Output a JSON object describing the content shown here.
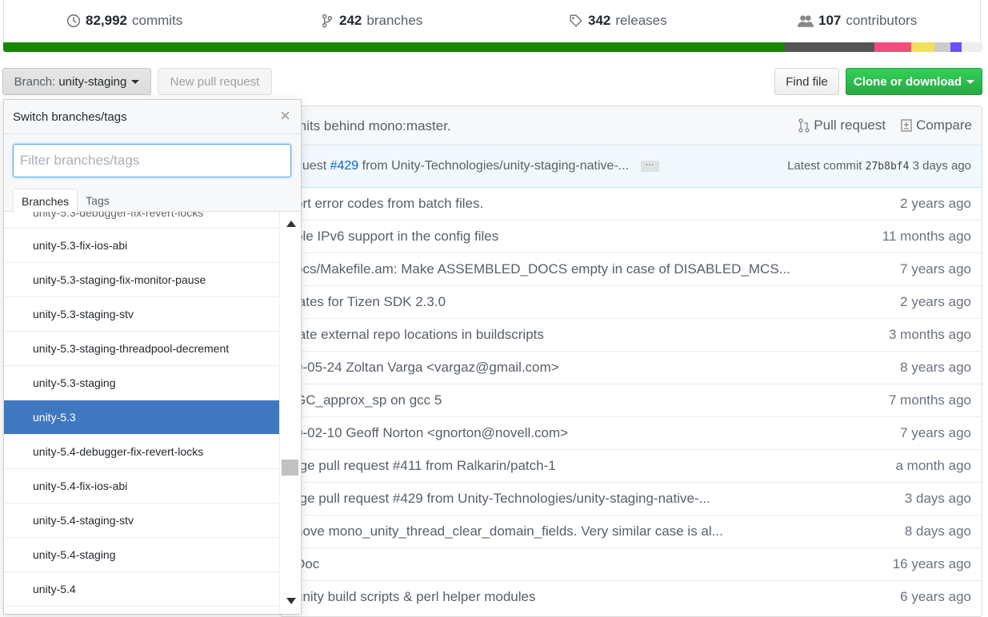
{
  "summary": {
    "commits": {
      "count": "82,992",
      "label": "commits",
      "icon": "history-icon"
    },
    "branches": {
      "count": "242",
      "label": "branches",
      "icon": "git-branch-icon"
    },
    "releases": {
      "count": "342",
      "label": "releases",
      "icon": "tag-icon"
    },
    "contributors": {
      "count": "107",
      "label": "contributors",
      "icon": "people-icon"
    }
  },
  "language_bar": [
    {
      "color": "#178600",
      "fraction": 0.797
    },
    {
      "color": "#555555",
      "fraction": 0.093
    },
    {
      "color": "#f34b7d",
      "fraction": 0.037
    },
    {
      "color": "#f1e05a",
      "fraction": 0.024
    },
    {
      "color": "#cccccc",
      "fraction": 0.016
    },
    {
      "color": "#6e4cff",
      "fraction": 0.012
    },
    {
      "color": "#ededed",
      "fraction": 0.021
    }
  ],
  "toolbar": {
    "branch_prefix": "Branch:",
    "branch_name": "unity-staging",
    "new_pr": "New pull request",
    "find_file": "Find file",
    "clone": "Clone or download"
  },
  "status": {
    "text": "mits behind mono:master.",
    "pull_request": "Pull request",
    "compare": "Compare"
  },
  "latest_commit": {
    "prefix": "quest",
    "pr_link": "#429",
    "rest": "from Unity-Technologies/unity-staging-native-...",
    "ellipsis": "···",
    "label": "Latest commit",
    "sha": "27b8bf4",
    "age": "3 days ago"
  },
  "files": [
    {
      "message": "ort error codes from batch files.",
      "age": "2 years ago"
    },
    {
      "message": "ble IPv6 support in the config files",
      "age": "11 months ago"
    },
    {
      "message": "ocs/Makefile.am: Make ASSEMBLED_DOCS empty in case of DISABLED_MCS...",
      "age": "7 years ago"
    },
    {
      "message": "lates for Tizen SDK 2.3.0",
      "age": "2 years ago"
    },
    {
      "message": "late external repo locations in buildscripts",
      "age": "3 months ago"
    },
    {
      "message": "9-05-24 Zoltan Varga <vargaz@gmail.com>",
      "age": "8 years ago"
    },
    {
      "message": "GC_approx_sp on gcc 5",
      "age": "7 months ago"
    },
    {
      "message": "0-02-10 Geoff Norton <gnorton@novell.com>",
      "age": "7 years ago"
    },
    {
      "message": "rge pull request #411 from Ralkarin/patch-1",
      "age": "a month ago"
    },
    {
      "message": "rge pull request #429 from Unity-Technologies/unity-staging-native-...",
      "age": "3 days ago"
    },
    {
      "message": "nove mono_unity_thread_clear_domain_fields. Very similar case is al...",
      "age": "8 days ago"
    },
    {
      "message": "Doc",
      "age": "16 years ago"
    },
    {
      "message": "unity build scripts & perl helper modules",
      "age": "6 years ago"
    }
  ],
  "dropdown": {
    "title": "Switch branches/tags",
    "close": "×",
    "filter_placeholder": "Filter branches/tags",
    "tabs": [
      "Branches",
      "Tags"
    ],
    "partial_item": "unity-5.3-debugger-fix-revert-locks",
    "items": [
      "unity-5.3-fix-ios-abi",
      "unity-5.3-staging-fix-monitor-pause",
      "unity-5.3-staging-stv",
      "unity-5.3-staging-threadpool-decrement",
      "unity-5.3-staging",
      "unity-5.3",
      "unity-5.4-debugger-fix-revert-locks",
      "unity-5.4-fix-ios-abi",
      "unity-5.4-staging-stv",
      "unity-5.4-staging",
      "unity-5.4"
    ],
    "selected": "unity-5.3"
  }
}
